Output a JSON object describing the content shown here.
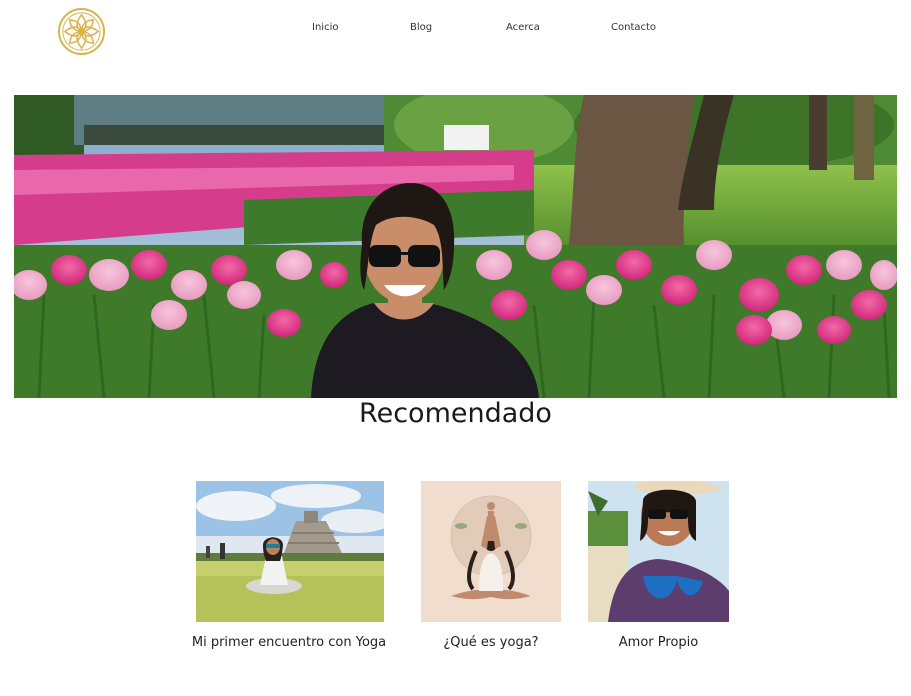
{
  "nav": {
    "items": [
      "Inicio",
      "Blog",
      "Acerca",
      "Contacto"
    ]
  },
  "recommended": {
    "title": "Recomendado",
    "posts": [
      {
        "label": "Mi primer encuentro con Yoga"
      },
      {
        "label": "¿Qué es yoga?"
      },
      {
        "label": "Amor Propio"
      }
    ]
  },
  "colors": {
    "logo_gold": "#d9b44a",
    "tulip_pink": "#e2438f",
    "tulip_light": "#f3b7d2",
    "grass": "#5c8a2e"
  },
  "icons": {
    "logo": "lotus-flower-icon"
  }
}
